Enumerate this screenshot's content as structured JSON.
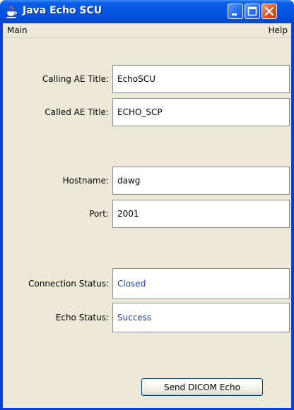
{
  "window": {
    "title": "Java Echo SCU",
    "app_icon": "java-cup-icon",
    "controls": [
      "minimize-icon",
      "maximize-icon",
      "close-icon"
    ]
  },
  "menu": {
    "main_label": "Main",
    "help_label": "Help"
  },
  "form": {
    "calling_ae_label": "Calling AE Title:",
    "calling_ae_value": "EchoSCU",
    "called_ae_label": "Called AE Title:",
    "called_ae_value": "ECHO_SCP",
    "hostname_label": "Hostname:",
    "hostname_value": "dawg",
    "port_label": "Port:",
    "port_value": "2001",
    "connection_status_label": "Connection Status:",
    "connection_status_value": "Closed",
    "echo_status_label": "Echo Status:",
    "echo_status_value": "Success"
  },
  "actions": {
    "send_echo_label": "Send DICOM Echo"
  },
  "colors": {
    "titlebar": "#0a5ee8",
    "window_bg": "#ece9d8",
    "status_text": "#1f3ad0"
  }
}
